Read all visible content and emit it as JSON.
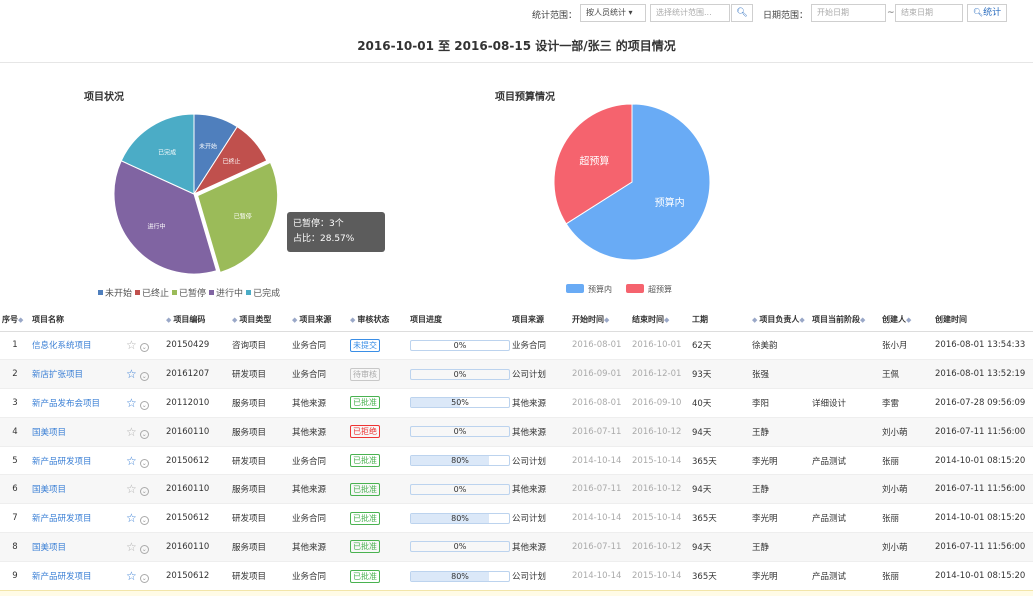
{
  "filter": {
    "stat_range_label": "统计范围：",
    "stat_mode_value": "按人员统计 ▾",
    "stat_range_placeholder": "选择统计范围...",
    "date_range_label": "日期范围：",
    "start_placeholder": "开始日期",
    "end_placeholder": "结束日期",
    "stat_button": "统计"
  },
  "page_title": "2016-10-01 至 2016-08-15   设计一部/张三 的项目情况",
  "chart_data": [
    {
      "type": "pie",
      "title": "项目状况",
      "categories": [
        "未开始",
        "已终止",
        "已暂停",
        "进行中",
        "已完成"
      ],
      "values": [
        1,
        1,
        3,
        4,
        2
      ],
      "colors": [
        "#4f7fbd",
        "#c0504d",
        "#9bbb59",
        "#8064a2",
        "#4bacc6"
      ],
      "legend": "bottom",
      "tooltip": {
        "line1": "已暂停：3个",
        "line2": "占比：28.57%"
      }
    },
    {
      "type": "pie",
      "title": "项目预算情况",
      "categories": [
        "预算内",
        "超预算"
      ],
      "values": [
        66,
        34
      ],
      "colors": [
        "#69abf5",
        "#f5636e"
      ],
      "legend": "bottom"
    }
  ],
  "table": {
    "headers": [
      "序号",
      "项目名称",
      "项目编码",
      "项目类型",
      "项目来源",
      "审核状态",
      "项目进度",
      "项目来源",
      "开始时间",
      "结束时间",
      "工期",
      "项目负责人",
      "项目当前阶段",
      "创建人",
      "创建时间"
    ],
    "rows": [
      {
        "idx": "1",
        "name": "信息化系统项目",
        "starred": false,
        "code": "20150429",
        "type": "咨询项目",
        "source": "业务合同",
        "status": "未提交",
        "status_color": "blue",
        "progress": 0,
        "progress_text": "0%",
        "source2": "业务合同",
        "start": "2016-08-01",
        "end": "2016-10-01",
        "days": "62天",
        "owner": "徐美韵",
        "stage": "",
        "creator": "张小月",
        "created": "2016-08-01 13:54:33"
      },
      {
        "idx": "2",
        "name": "新店扩张项目",
        "starred": true,
        "code": "20161207",
        "type": "研发项目",
        "source": "业务合同",
        "status": "待审核",
        "status_color": "gray",
        "progress": 0,
        "progress_text": "0%",
        "source2": "公司计划",
        "start": "2016-09-01",
        "end": "2016-12-01",
        "days": "93天",
        "owner": "张强",
        "stage": "",
        "creator": "王佩",
        "created": "2016-08-01 13:52:19"
      },
      {
        "idx": "3",
        "name": "新产品发布会项目",
        "starred": true,
        "code": "20112010",
        "type": "服务项目",
        "source": "其他来源",
        "status": "已批准",
        "status_color": "green",
        "progress": 50,
        "progress_text": "50%",
        "source2": "其他来源",
        "start": "2016-08-01",
        "end": "2016-09-10",
        "days": "40天",
        "owner": "李阳",
        "stage": "详细设计",
        "creator": "李雷",
        "created": "2016-07-28 09:56:09"
      },
      {
        "idx": "4",
        "name": "国美项目",
        "starred": false,
        "code": "20160110",
        "type": "服务项目",
        "source": "其他来源",
        "status": "已拒绝",
        "status_color": "red",
        "progress": 0,
        "progress_text": "0%",
        "source2": "其他来源",
        "start": "2016-07-11",
        "end": "2016-10-12",
        "days": "94天",
        "owner": "王静",
        "stage": "",
        "creator": "刘小萌",
        "created": "2016-07-11 11:56:00"
      },
      {
        "idx": "5",
        "name": "新产品研发项目",
        "starred": true,
        "code": "20150612",
        "type": "研发项目",
        "source": "业务合同",
        "status": "已批准",
        "status_color": "green",
        "progress": 80,
        "progress_text": "80%",
        "source2": "公司计划",
        "start": "2014-10-14",
        "end": "2015-10-14",
        "days": "365天",
        "owner": "李光明",
        "stage": "产品测试",
        "creator": "张丽",
        "created": "2014-10-01 08:15:20"
      },
      {
        "idx": "6",
        "name": "国美项目",
        "starred": false,
        "code": "20160110",
        "type": "服务项目",
        "source": "其他来源",
        "status": "已批准",
        "status_color": "green",
        "progress": 0,
        "progress_text": "0%",
        "source2": "其他来源",
        "start": "2016-07-11",
        "end": "2016-10-12",
        "days": "94天",
        "owner": "王静",
        "stage": "",
        "creator": "刘小萌",
        "created": "2016-07-11 11:56:00"
      },
      {
        "idx": "7",
        "name": "新产品研发项目",
        "starred": true,
        "code": "20150612",
        "type": "研发项目",
        "source": "业务合同",
        "status": "已批准",
        "status_color": "green",
        "progress": 80,
        "progress_text": "80%",
        "source2": "公司计划",
        "start": "2014-10-14",
        "end": "2015-10-14",
        "days": "365天",
        "owner": "李光明",
        "stage": "产品测试",
        "creator": "张丽",
        "created": "2014-10-01 08:15:20"
      },
      {
        "idx": "8",
        "name": "国美项目",
        "starred": false,
        "code": "20160110",
        "type": "服务项目",
        "source": "其他来源",
        "status": "已批准",
        "status_color": "green",
        "progress": 0,
        "progress_text": "0%",
        "source2": "其他来源",
        "start": "2016-07-11",
        "end": "2016-10-12",
        "days": "94天",
        "owner": "王静",
        "stage": "",
        "creator": "刘小萌",
        "created": "2016-07-11 11:56:00"
      },
      {
        "idx": "9",
        "name": "新产品研发项目",
        "starred": true,
        "code": "20150612",
        "type": "研发项目",
        "source": "业务合同",
        "status": "已批准",
        "status_color": "green",
        "progress": 80,
        "progress_text": "80%",
        "source2": "公司计划",
        "start": "2014-10-14",
        "end": "2015-10-14",
        "days": "365天",
        "owner": "李光明",
        "stage": "产品测试",
        "creator": "张丽",
        "created": "2014-10-01 08:15:20"
      }
    ]
  }
}
